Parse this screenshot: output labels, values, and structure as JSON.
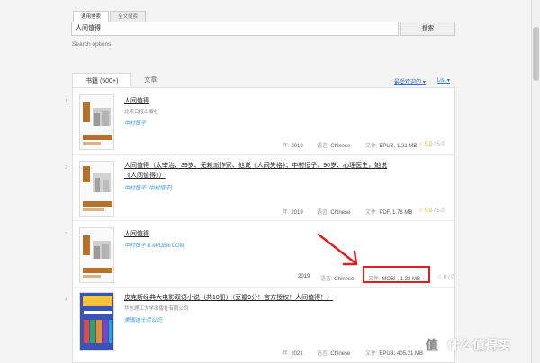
{
  "search": {
    "tabs": [
      "通用搜索",
      "全文搜索"
    ],
    "query": "人间值得",
    "button_label": "搜索",
    "options_label": "Search options"
  },
  "results_tabs": [
    "书籍 (500+)",
    "文章"
  ],
  "sort": {
    "label": "最受欢迎的",
    "view_label": "List"
  },
  "books": [
    {
      "index": "1",
      "title": "人间值得",
      "publisher": "北京日报出版社",
      "author": "中村恒子",
      "year_label": "年:",
      "year": "2019",
      "lang_label": "语言:",
      "language": "Chinese",
      "file_label": "文件:",
      "file": "EPUB, 1.21 MB",
      "rating": "5.0",
      "rating_total": "5.0"
    },
    {
      "index": "2",
      "title": "人间值得（太宰治、39岁、无赖派作家、他说《人间失格》；中村恒子、90岁、心理医生，她说《人间值得》）",
      "author": "中村恒子 [中村恒子]",
      "year_label": "年:",
      "year": "2019",
      "lang_label": "语言:",
      "language": "Chinese",
      "file_label": "文件:",
      "file": "PDF, 1.76 MB",
      "rating": "5.0",
      "rating_total": "5.0"
    },
    {
      "index": "3",
      "title": "人间值得",
      "author": "中村恒子 & ePUBw.COM",
      "year_label": "年:",
      "year": "2019",
      "lang_label": "语言:",
      "language": "Chinese",
      "file_label": "文件:",
      "file": "MOBI , 1.32 MB",
      "rating": "0",
      "rating_total": "0"
    },
    {
      "index": "4",
      "title": "皮克斯经典大电影双语小说（共10册）（豆瓣9分！官方授权！人间值得！）",
      "publisher": "华东理工大学出版社有限公司",
      "author": "美国迪士尼公司",
      "year_label": "年:",
      "year": "2021",
      "lang_label": "语言:",
      "language": "Chinese",
      "file_label": "文件:",
      "file": "EPUB, 405.21 MB"
    }
  ],
  "watermark": "什么值得买",
  "colors": {
    "link": "#3a6fb4",
    "author": "#3c9ad6",
    "rating": "#e0a000",
    "annotation": "#e02020"
  }
}
